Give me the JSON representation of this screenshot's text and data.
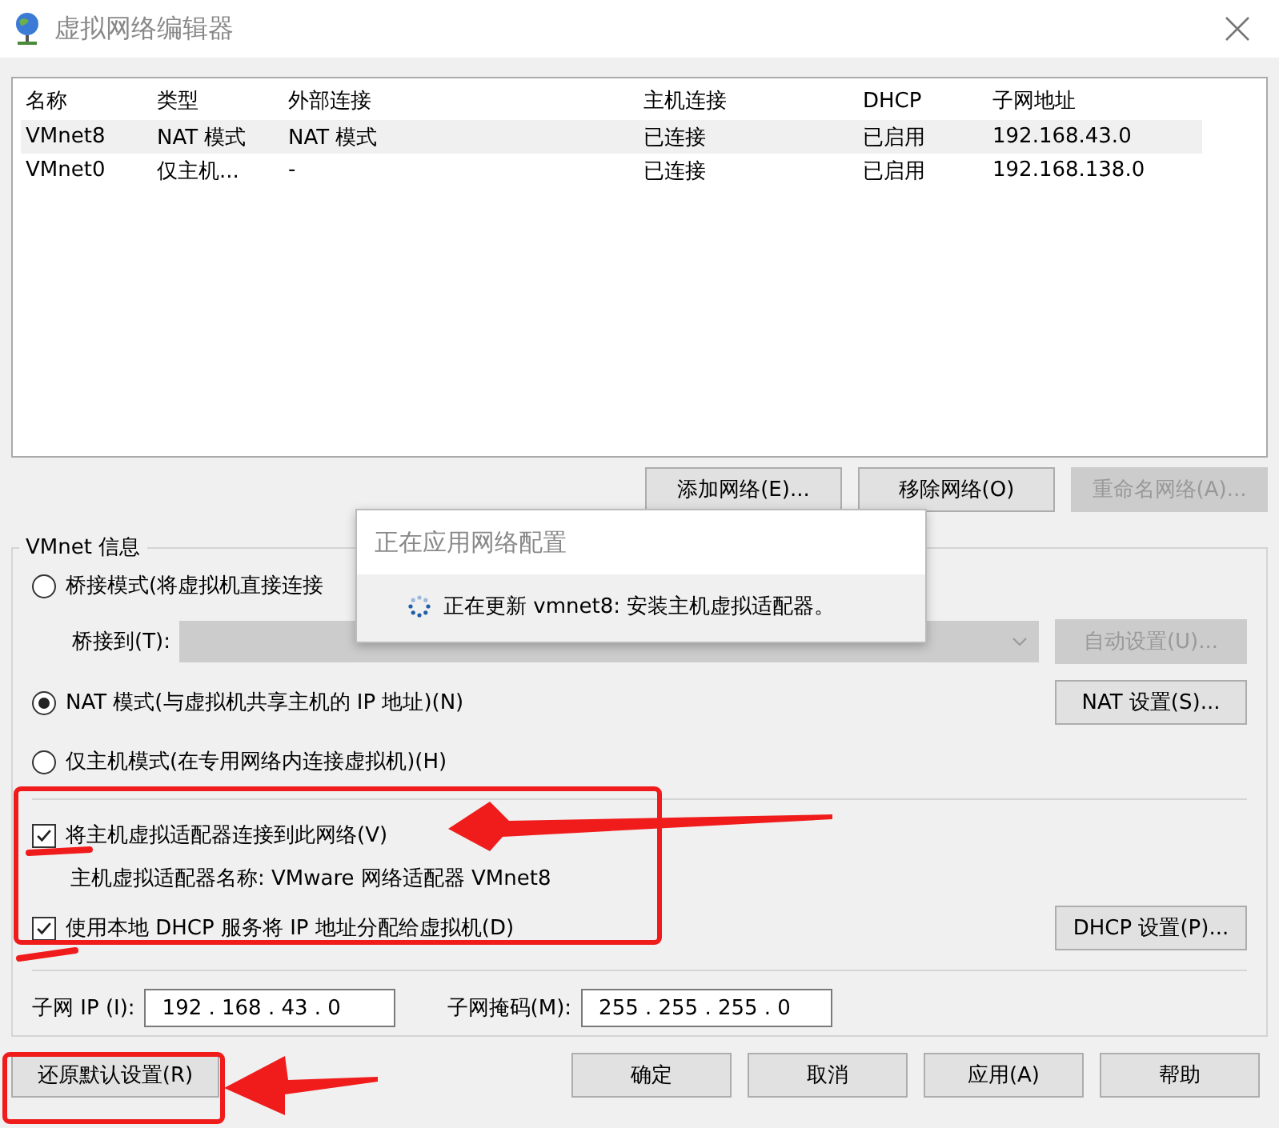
{
  "window": {
    "title": "虚拟网络编辑器"
  },
  "table": {
    "columns": [
      "名称",
      "类型",
      "外部连接",
      "主机连接",
      "DHCP",
      "子网地址"
    ],
    "rows": [
      {
        "cells": [
          "VMnet8",
          "NAT 模式",
          "NAT 模式",
          "已连接",
          "已启用",
          "192.168.43.0"
        ],
        "selected": true
      },
      {
        "cells": [
          "VMnet0",
          "仅主机...",
          "-",
          "已连接",
          "已启用",
          "192.168.138.0"
        ],
        "selected": false
      }
    ]
  },
  "network_buttons": [
    {
      "label": "添加网络(E)...",
      "disabled": false
    },
    {
      "label": "移除网络(O)",
      "disabled": false
    },
    {
      "label": "重命名网络(A)...",
      "disabled": true
    }
  ],
  "vmnet_info": {
    "title": "VMnet 信息",
    "bridged_mode": {
      "label": "桥接模式(将虚拟机直接连接",
      "selected": false
    },
    "bridge_to": {
      "label": "桥接到(T):",
      "disabled": true,
      "button": "自动设置(U)..."
    },
    "nat_mode": {
      "label": "NAT 模式(与虚拟机共享主机的 IP 地址)(N)",
      "selected": true,
      "button": "NAT 设置(S)..."
    },
    "host_only_mode": {
      "label": "仅主机模式(在专用网络内连接虚拟机)(H)",
      "selected": false
    },
    "connect_adapter": {
      "label": "将主机虚拟适配器连接到此网络(V)",
      "checked": true
    },
    "adapter_name": "主机虚拟适配器名称: VMware 网络适配器 VMnet8",
    "use_dhcp": {
      "label": "使用本地 DHCP 服务将 IP 地址分配给虚拟机(D)",
      "checked": true,
      "button": "DHCP 设置(P)..."
    },
    "subnet_ip": {
      "label": "子网 IP (I):",
      "value": "192 . 168 . 43 . 0"
    },
    "subnet_mask": {
      "label": "子网掩码(M):",
      "value": "255 . 255 . 255 . 0"
    }
  },
  "restore_button": "还原默认设置(R)",
  "footer_buttons": [
    "确定",
    "取消",
    "应用(A)",
    "帮助"
  ],
  "progress_dialog": {
    "title": "正在应用网络配置",
    "message": "正在更新 vmnet8: 安装主机虚拟适配器。"
  }
}
